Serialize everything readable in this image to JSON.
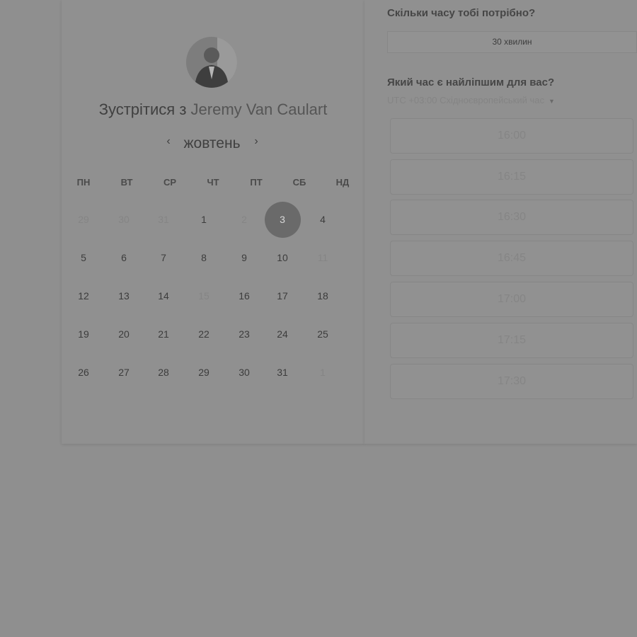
{
  "title": {
    "prefix": "Зустрітися з",
    "host": "Jeremy Van Caulart"
  },
  "calendar": {
    "month": "жовтень",
    "weekdays": [
      "ПН",
      "ВТ",
      "СР",
      "ЧТ",
      "ПТ",
      "СБ",
      "НД"
    ],
    "selected_day": "3",
    "weeks": [
      [
        "29",
        "30",
        "31",
        "1",
        "2",
        "3",
        "4"
      ],
      [
        "5",
        "6",
        "7",
        "8",
        "9",
        "10",
        "11"
      ],
      [
        "12",
        "13",
        "14",
        "15",
        "16",
        "17",
        "18"
      ],
      [
        "19",
        "20",
        "21",
        "22",
        "23",
        "24",
        "25"
      ],
      [
        "26",
        "27",
        "28",
        "29",
        "30",
        "31",
        "1"
      ]
    ]
  },
  "duration": {
    "question": "Скільки часу тобі потрібно?",
    "value": "30 хвилин"
  },
  "time": {
    "question": "Який час є найліпшим для вас?",
    "timezone": "UTC +03:00 Східноєвропейський час"
  },
  "slots": [
    "16:00",
    "16:15",
    "16:30",
    "16:45",
    "17:00",
    "17:15",
    "17:30"
  ],
  "icons": {
    "prev": "chevron-left-icon",
    "next": "chevron-right-icon",
    "tz_dropdown": "caret-down-icon"
  },
  "colors": {
    "overlay_bg": "#8f8f8f",
    "selected_day_bg": "#6a6a6a"
  }
}
